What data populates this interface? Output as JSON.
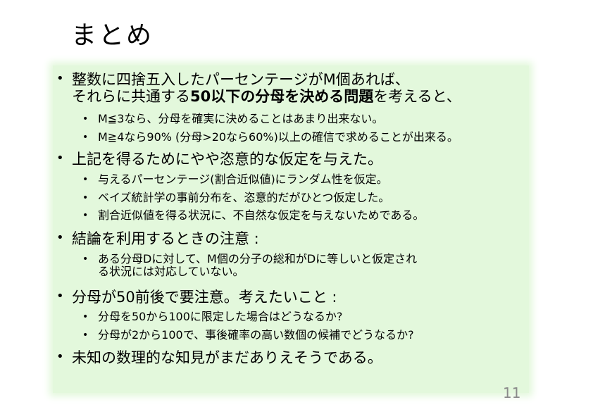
{
  "title": "まとめ",
  "bullets": {
    "b1": {
      "line1": "整数に四捨五入したパーセンテージがM個あれば、",
      "line2_pre": "それらに共通する",
      "line2_bold": "50以下の分母を決める問題",
      "line2_post": "を考えると、",
      "sub1": "M≦3なら、分母を確実に決めることはあまり出来ない。",
      "sub2": "M≧4なら90% (分母>20なら60%)以上の確信で求めることが出来る。"
    },
    "b2": {
      "line1": "上記を得るためにやや恣意的な仮定を与えた。",
      "sub1": "与えるパーセンテージ(割合近似値)にランダム性を仮定。",
      "sub2": "ベイズ統計学の事前分布を、恣意的だがひとつ仮定した。",
      "sub3": "割合近似値を得る状況に、不自然な仮定を与えないためである。"
    },
    "b3": {
      "line1": "結論を利用するときの注意 :",
      "sub1_line1": "ある分母Dに対して、M個の分子の総和がDに等しいと仮定され",
      "sub1_line2": "る状況には対応していない。"
    },
    "b4": {
      "line1": "分母が50前後で要注意。考えたいこと :",
      "sub1": "分母を50から100に限定した場合はどうなるか?",
      "sub2": "分母が2から100で、事後確率の高い数個の候補でどうなるか?"
    },
    "b5": {
      "line1": "未知の数理的な知見がまだありえそうである。"
    }
  },
  "page_number": "11",
  "colors": {
    "content_background": "#e3f8dc",
    "page_number": "#8a8a8a"
  }
}
